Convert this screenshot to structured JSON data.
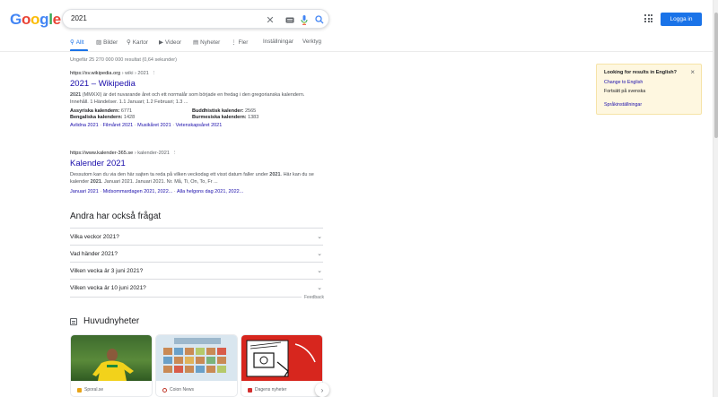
{
  "logo": {
    "letters": [
      "G",
      "o",
      "o",
      "g",
      "l",
      "e"
    ],
    "colors": [
      "#4285f4",
      "#ea4335",
      "#fbbc05",
      "#4285f4",
      "#34a853",
      "#ea4335"
    ]
  },
  "search": {
    "query": "2021"
  },
  "header": {
    "login_label": "Logga in"
  },
  "tabs": [
    {
      "label": "Allt",
      "icon": "search-icon"
    },
    {
      "label": "Bilder",
      "icon": "image-icon"
    },
    {
      "label": "Kartor",
      "icon": "map-pin-icon"
    },
    {
      "label": "Videor",
      "icon": "video-icon"
    },
    {
      "label": "Nyheter",
      "icon": "news-icon"
    },
    {
      "label": "Fler",
      "icon": "more-icon"
    },
    {
      "label": "Inställningar"
    },
    {
      "label": "Verktyg"
    }
  ],
  "stats": "Ungefär 25 270 000 000 resultat (0,64 sekunder)",
  "results": [
    {
      "url": "https://sv.wikipedia.org",
      "breadcrumb": " › wiki › 2021",
      "title": "2021 – Wikipedia",
      "snippet_bold": "2021",
      "snippet": " (MMXXI) är det nuvarande året och ett normalår som började en fredag i den gregorianska kalendern. Innehåll. 1 Händelser. 1.1 Januari; 1.2 Februari; 1.3 ...",
      "facts": [
        {
          "label": "Assyriska kalendern:",
          "value": "6771"
        },
        {
          "label": "Buddhistisk kalender:",
          "value": "2565"
        },
        {
          "label": "Bengaliska kalendern:",
          "value": "1428"
        },
        {
          "label": "Burmesiska kalendern:",
          "value": "1383"
        }
      ],
      "sitelinks": [
        "Avlidna 2021",
        "Filmåret 2021",
        "Musikåret 2021",
        "Vetenskapsåret 2021"
      ]
    },
    {
      "url": "https://www.kalender-365.se",
      "breadcrumb": " › kalender-2021",
      "title": "Kalender 2021",
      "snippet_pre": "Dessutom kan du via den här sajten ta reda på vilken veckodag ett visst datum faller under ",
      "snippet_b1": "2021",
      "snippet_mid": ". Här kan du se kalender ",
      "snippet_b2": "2021",
      "snippet_post": ". Januari 2021. Januari 2021. Nr. Må, Ti, On, To, Fr ...",
      "sitelinks": [
        "Januari 2021",
        "Midsommardagen 2021, 2022...",
        "Alla helgons dag 2021, 2022..."
      ]
    }
  ],
  "paa": {
    "title": "Andra har också frågat",
    "questions": [
      "Vilka veckor 2021?",
      "Vad händer 2021?",
      "Vilken vecka är 3 juni 2021?",
      "Vilken vecka är 10 juni 2021?"
    ],
    "feedback": "Feedback"
  },
  "news": {
    "title": "Huvudnyheter",
    "cards": [
      {
        "source": "Sporal.se",
        "fav_color": "#e8a317"
      },
      {
        "source": "Coion News",
        "fav_color": "#c0392b"
      },
      {
        "source": "Dagens nyheter",
        "fav_color": "#d32f2f"
      }
    ]
  },
  "lang_box": {
    "title": "Looking for results in English?",
    "change_link": "Change to English",
    "keep_link": "Fortsätt på svenska",
    "settings_link": "Språkinställningar"
  }
}
